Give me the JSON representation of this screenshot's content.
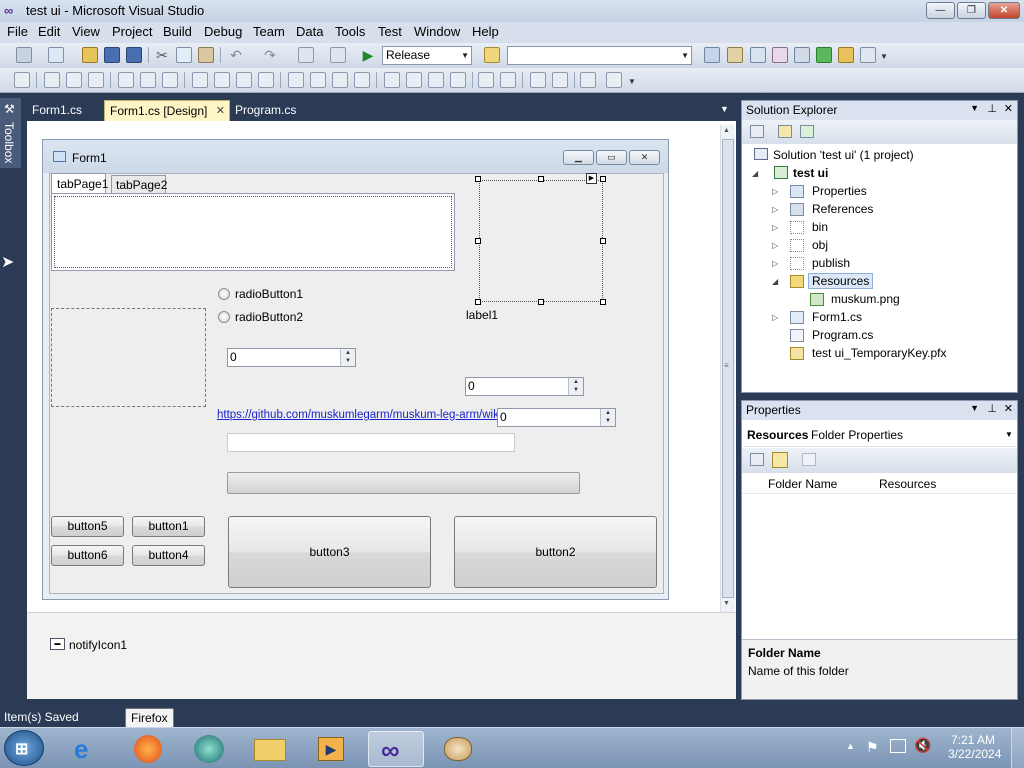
{
  "window": {
    "title": "test ui - Microsoft Visual Studio",
    "minimize": "—",
    "restore": "❐",
    "close": "✕"
  },
  "menu": [
    "File",
    "Edit",
    "View",
    "Project",
    "Build",
    "Debug",
    "Team",
    "Data",
    "Tools",
    "Test",
    "Window",
    "Help"
  ],
  "toolbar": {
    "configuration": "Release",
    "platform": ""
  },
  "toolbox_label": "Toolbox",
  "doc_tabs": [
    "Form1.cs",
    "Form1.cs [Design]",
    "Program.cs"
  ],
  "doc_tab_close": "✕",
  "form": {
    "title": "Form1",
    "tab1": "tabPage1",
    "tab2": "tabPage2",
    "radio1": "radioButton1",
    "radio2": "radioButton2",
    "label1": "label1",
    "numeric1": "0",
    "numeric2": "0",
    "numeric3": "0",
    "link": "https://github.com/muskumlegarm/muskum-leg-arm/wiki",
    "textbox": "",
    "button1": "button1",
    "button2": "button2",
    "button3": "button3",
    "button4": "button4",
    "button5": "button5",
    "button6": "button6"
  },
  "tray": {
    "notify": "notifyIcon1"
  },
  "solution_explorer": {
    "title": "Solution Explorer",
    "solution": "Solution 'test ui' (1 project)",
    "project": "test ui",
    "items": [
      {
        "label": "Properties",
        "expander": "▷"
      },
      {
        "label": "References",
        "expander": "▷"
      },
      {
        "label": "bin",
        "expander": "▷"
      },
      {
        "label": "obj",
        "expander": "▷"
      },
      {
        "label": "publish",
        "expander": "▷"
      },
      {
        "label": "Resources",
        "expander": "◢"
      },
      {
        "label": "muskum.png",
        "expander": ""
      },
      {
        "label": "Form1.cs",
        "expander": "▷"
      },
      {
        "label": "Program.cs",
        "expander": ""
      },
      {
        "label": "test ui_TemporaryKey.pfx",
        "expander": ""
      }
    ]
  },
  "properties": {
    "title": "Properties",
    "object_name": "Resources",
    "object_type": "Folder Properties",
    "row_name": "Folder Name",
    "row_value": "Resources",
    "desc_title": "Folder Name",
    "desc_text": "Name of this folder"
  },
  "status": "Item(s) Saved",
  "tooltip": "Firefox",
  "clock": {
    "time": "7:21 AM",
    "date": "3/22/2024"
  }
}
